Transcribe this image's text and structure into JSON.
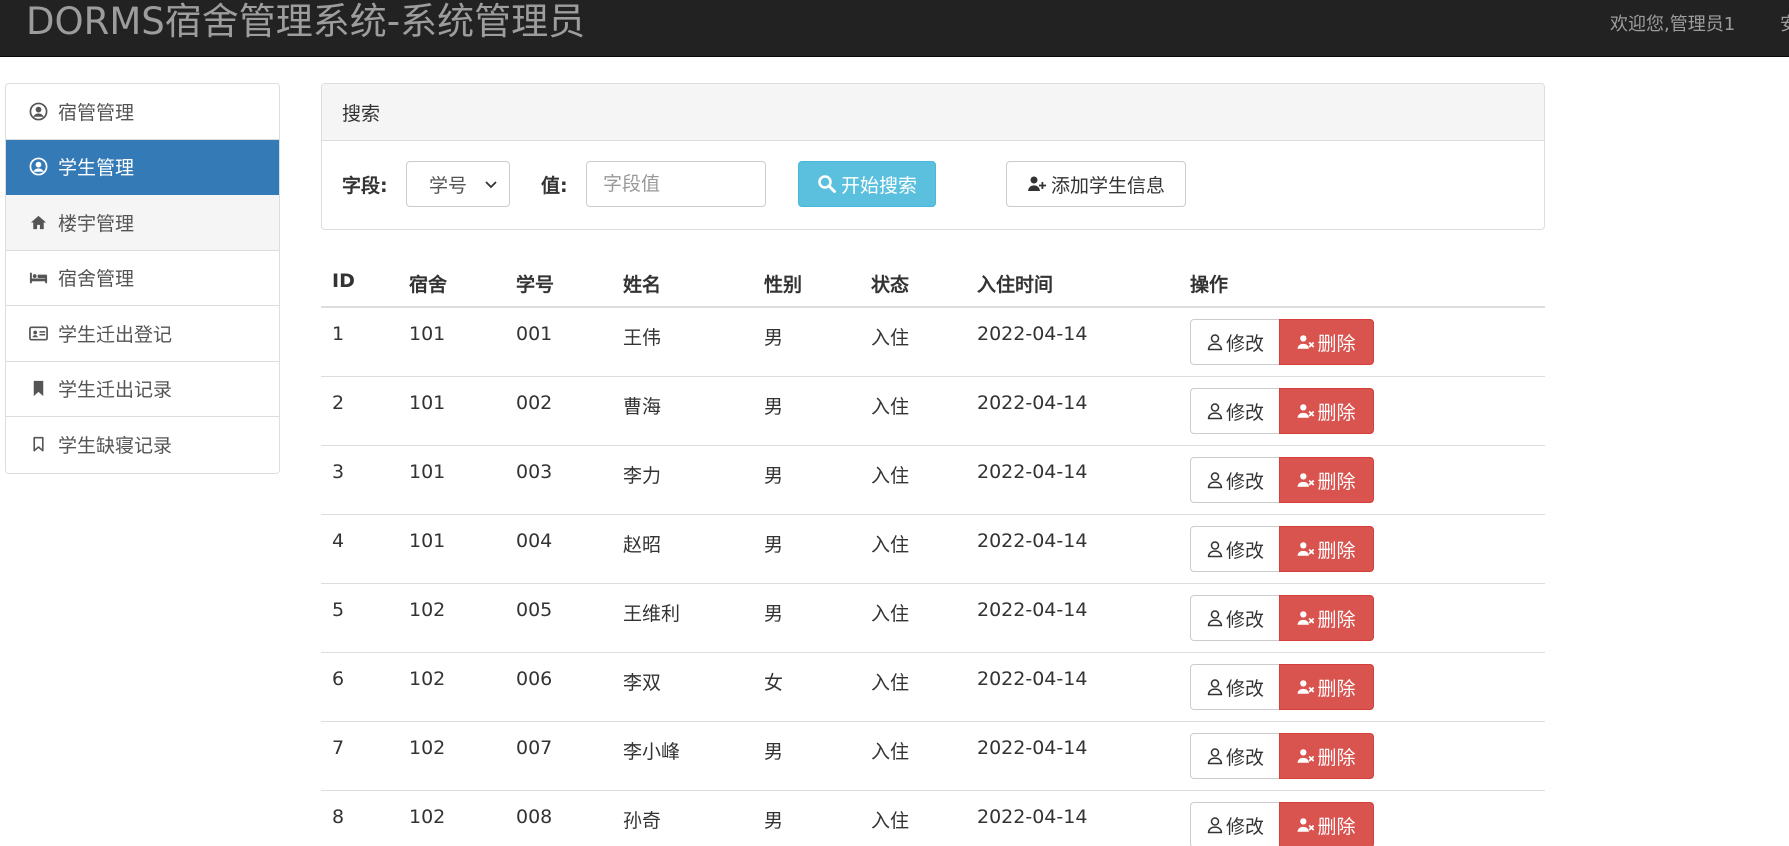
{
  "navbar": {
    "brand": "DORMS宿舍管理系统-系统管理员",
    "welcome": "欢迎您,管理员1",
    "cut_text": "安"
  },
  "sidebar": {
    "items": [
      {
        "label": "宿管管理",
        "icon": "user-circle-icon",
        "state": "normal"
      },
      {
        "label": "学生管理",
        "icon": "user-circle-icon",
        "state": "active"
      },
      {
        "label": "楼宇管理",
        "icon": "home-icon",
        "state": "hover"
      },
      {
        "label": "宿舍管理",
        "icon": "bed-icon",
        "state": "normal"
      },
      {
        "label": "学生迁出登记",
        "icon": "id-card-icon",
        "state": "normal"
      },
      {
        "label": "学生迁出记录",
        "icon": "bookmark-icon",
        "state": "normal"
      },
      {
        "label": "学生缺寝记录",
        "icon": "bookmark-outline-icon",
        "state": "normal"
      }
    ],
    "active_color": "#337ab7"
  },
  "search": {
    "title": "搜索",
    "field_label": "字段:",
    "field_selected": "学号",
    "value_label": "值:",
    "value_placeholder": "字段值",
    "search_button": "开始搜索",
    "add_button": "添加学生信息",
    "search_color": "#5bc0de"
  },
  "table": {
    "headers": {
      "id": "ID",
      "dorm": "宿舍",
      "sno": "学号",
      "name": "姓名",
      "sex": "性别",
      "state": "状态",
      "time": "入住时间",
      "op": "操作"
    },
    "edit_label": "修改",
    "delete_label": "删除",
    "delete_color": "#d9534f",
    "rows": [
      {
        "id": "1",
        "dorm": "101",
        "sno": "001",
        "name": "王伟",
        "sex": "男",
        "state": "入住",
        "time": "2022-04-14"
      },
      {
        "id": "2",
        "dorm": "101",
        "sno": "002",
        "name": "曹海",
        "sex": "男",
        "state": "入住",
        "time": "2022-04-14"
      },
      {
        "id": "3",
        "dorm": "101",
        "sno": "003",
        "name": "李力",
        "sex": "男",
        "state": "入住",
        "time": "2022-04-14"
      },
      {
        "id": "4",
        "dorm": "101",
        "sno": "004",
        "name": "赵昭",
        "sex": "男",
        "state": "入住",
        "time": "2022-04-14"
      },
      {
        "id": "5",
        "dorm": "102",
        "sno": "005",
        "name": "王维利",
        "sex": "男",
        "state": "入住",
        "time": "2022-04-14"
      },
      {
        "id": "6",
        "dorm": "102",
        "sno": "006",
        "name": "李双",
        "sex": "女",
        "state": "入住",
        "time": "2022-04-14"
      },
      {
        "id": "7",
        "dorm": "102",
        "sno": "007",
        "name": "李小峰",
        "sex": "男",
        "state": "入住",
        "time": "2022-04-14"
      },
      {
        "id": "8",
        "dorm": "102",
        "sno": "008",
        "name": "孙奇",
        "sex": "男",
        "state": "入住",
        "time": "2022-04-14"
      }
    ]
  }
}
